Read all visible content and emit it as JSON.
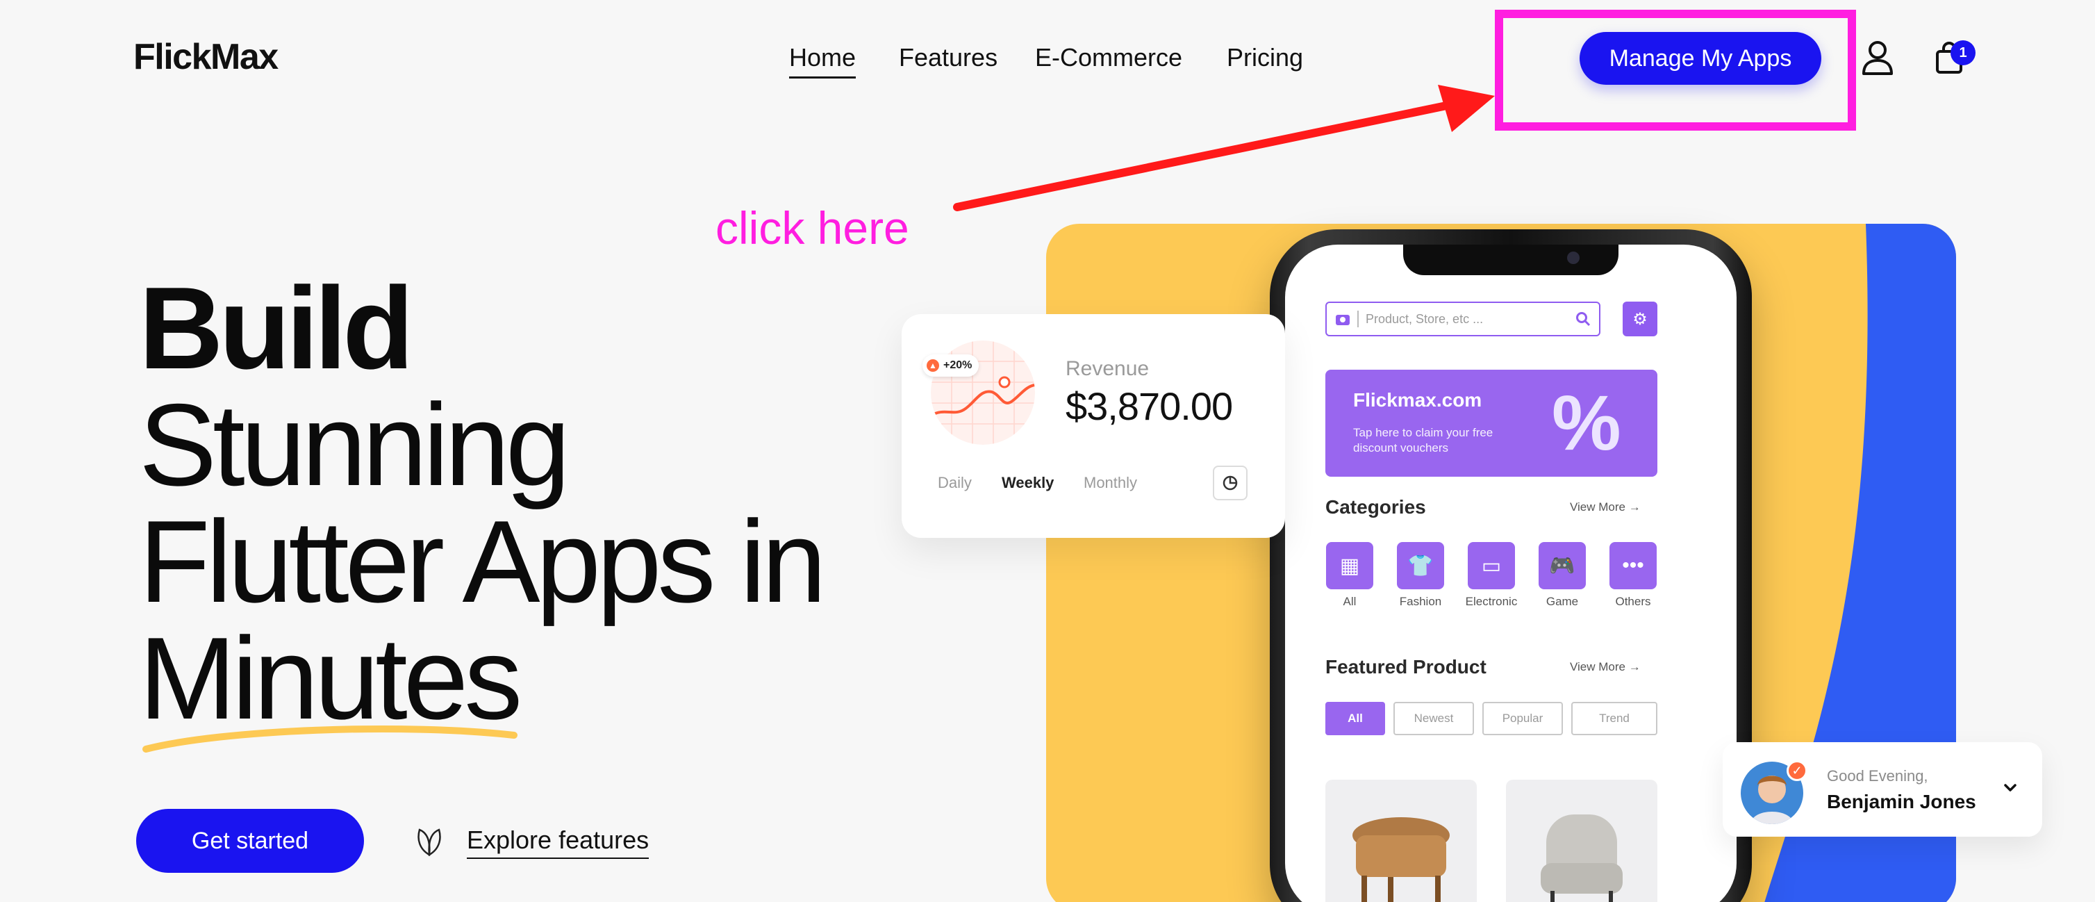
{
  "header": {
    "logo": "FlickMax",
    "nav": [
      {
        "label": "Home",
        "active": true
      },
      {
        "label": "Features",
        "active": false
      },
      {
        "label": "E-Commerce",
        "active": false
      },
      {
        "label": "Pricing",
        "active": false
      }
    ],
    "manage_button": "Manage My Apps",
    "cart_count": "1",
    "icons": [
      "user-icon",
      "shopping-bag-icon"
    ]
  },
  "annotation": {
    "text": "click here",
    "color": "#ff1ee0",
    "arrow_color": "#ff1a1a"
  },
  "hero": {
    "line1": "Build",
    "line2": "Stunning",
    "line3": "Flutter Apps in",
    "line4": "Minutes",
    "cta": "Get started",
    "explore": "Explore features"
  },
  "revenue_card": {
    "badge": "+20%",
    "label": "Revenue",
    "value": "$3,870.00",
    "tabs": [
      {
        "label": "Daily",
        "active": false
      },
      {
        "label": "Weekly",
        "active": true
      },
      {
        "label": "Monthly",
        "active": false
      }
    ]
  },
  "phone": {
    "search_placeholder": "Product, Store, etc ...",
    "promo": {
      "title": "Flickmax.com",
      "subtitle": "Tap here to claim your free discount vouchers",
      "symbol": "%"
    },
    "categories_title": "Categories",
    "view_more": "View More",
    "categories": [
      {
        "label": "All",
        "icon": "grid-icon"
      },
      {
        "label": "Fashion",
        "icon": "tshirt-icon"
      },
      {
        "label": "Electronic",
        "icon": "monitor-icon"
      },
      {
        "label": "Game",
        "icon": "gamepad-icon"
      },
      {
        "label": "Others",
        "icon": "more-icon"
      }
    ],
    "featured_title": "Featured Product",
    "filters": [
      {
        "label": "All",
        "active": true
      },
      {
        "label": "Newest",
        "active": false
      },
      {
        "label": "Popular",
        "active": false
      },
      {
        "label": "Trend",
        "active": false
      }
    ]
  },
  "greeting": {
    "small": "Good Evening,",
    "name": "Benjamin Jones"
  },
  "colors": {
    "accent": "#1a14f0",
    "purple": "#9966ef",
    "yellow": "#fdc954",
    "blue": "#2f5cf3"
  }
}
